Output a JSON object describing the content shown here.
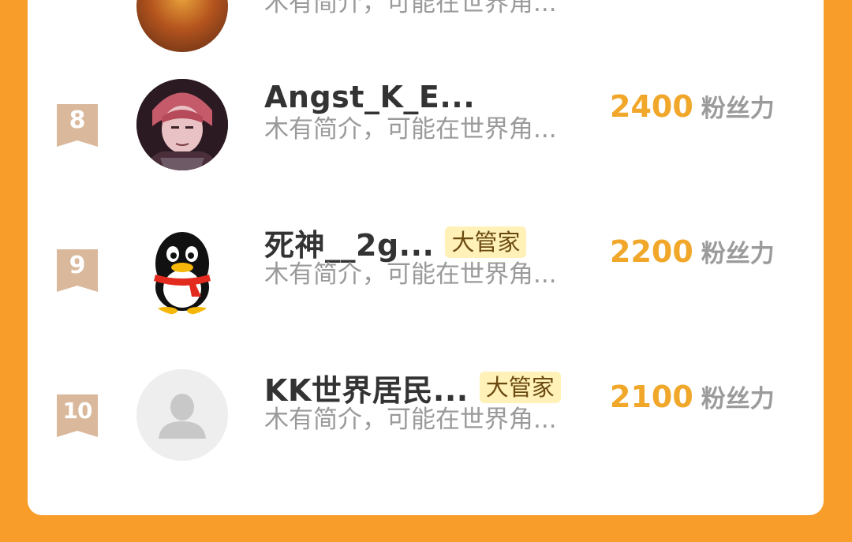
{
  "colors": {
    "page_bg": "#f89d2a",
    "card_bg": "#ffffff",
    "stat_value": "#f0a72a",
    "rank_badge": "#d9b89c",
    "role_tag_bg": "#fff1b8"
  },
  "top_partial": {
    "intro": "木有简介，可能在世界角..."
  },
  "rows": [
    {
      "rank": "8",
      "name": "Angst_K_E...",
      "intro": "木有简介，可能在世界角...",
      "value": "2400",
      "unit": "粉丝力",
      "avatar_icon": "anime-avatar"
    },
    {
      "rank": "9",
      "name": "死神__2g...",
      "tag": "大管家",
      "intro": "木有简介，可能在世界角...",
      "value": "2200",
      "unit": "粉丝力",
      "avatar_icon": "qq-penguin-avatar"
    },
    {
      "rank": "10",
      "name": "KK世界居民...",
      "tag": "大管家",
      "intro": "木有简介，可能在世界角...",
      "value": "2100",
      "unit": "粉丝力",
      "avatar_icon": "default-user-avatar"
    }
  ]
}
